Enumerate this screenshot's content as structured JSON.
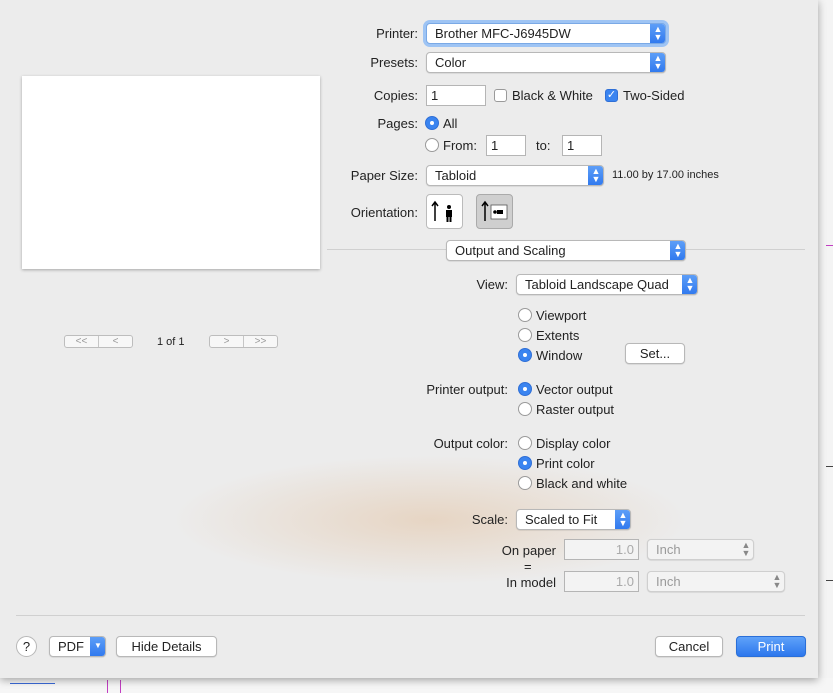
{
  "printer": {
    "label": "Printer:",
    "value": "Brother MFC-J6945DW"
  },
  "presets": {
    "label": "Presets:",
    "value": "Color"
  },
  "copies": {
    "label": "Copies:",
    "value": "1",
    "bw_label": "Black & White",
    "bw_checked": false,
    "two_sided_label": "Two-Sided",
    "two_sided_checked": true
  },
  "pages": {
    "label": "Pages:",
    "all_label": "All",
    "from_label": "From:",
    "from_value": "1",
    "to_label": "to:",
    "to_value": "1",
    "selected": "All"
  },
  "paper_size": {
    "label": "Paper Size:",
    "value": "Tabloid",
    "dimensions": "11.00 by 17.00 inches"
  },
  "orientation": {
    "label": "Orientation:",
    "options": [
      "portrait-icon",
      "landscape-icon"
    ],
    "selected": "landscape"
  },
  "preview": {
    "page_indicator": "1 of 1",
    "first": "<<",
    "prev": "<",
    "next": ">",
    "last": ">>"
  },
  "section": {
    "value": "Output and Scaling"
  },
  "view": {
    "label": "View:",
    "value": "Tabloid Landscape Quad",
    "options": [
      "Viewport",
      "Extents",
      "Window"
    ],
    "selected": "Window",
    "set_button": "Set..."
  },
  "printer_output": {
    "label": "Printer output:",
    "options": [
      "Vector output",
      "Raster output"
    ],
    "selected": "Vector output"
  },
  "output_color": {
    "label": "Output color:",
    "options": [
      "Display color",
      "Print color",
      "Black and white"
    ],
    "selected": "Print color"
  },
  "scale": {
    "label": "Scale:",
    "value": "Scaled to Fit",
    "on_paper_label": "On paper",
    "equals": "=",
    "in_model_label": "In model",
    "on_paper_value": "1.0",
    "on_paper_unit": "Inch",
    "in_model_value": "1.0",
    "in_model_unit": "Inch"
  },
  "footer": {
    "help": "?",
    "pdf": "PDF",
    "hide_details": "Hide Details",
    "cancel": "Cancel",
    "print": "Print"
  },
  "colors": {
    "accent": "#3a84f0",
    "sheet_bg": "#ececec",
    "magenta_lines": "#c23fc2"
  }
}
